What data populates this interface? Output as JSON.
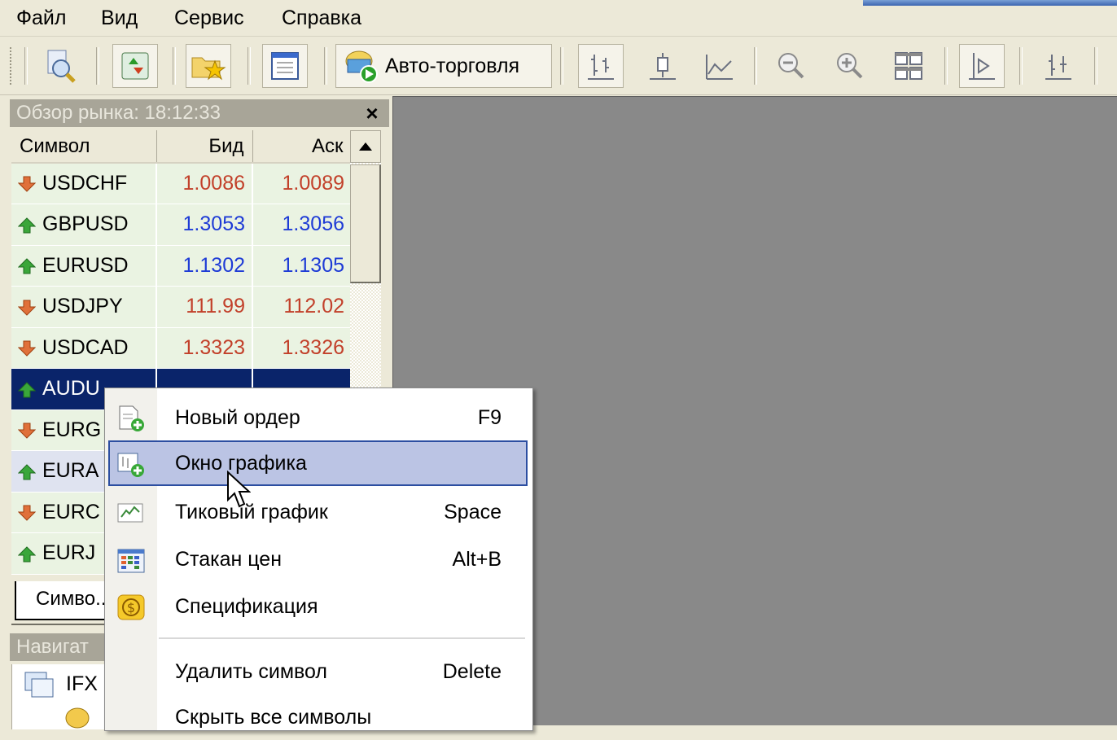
{
  "menubar": {
    "file": "Файл",
    "view": "Вид",
    "service": "Сервис",
    "help": "Справка"
  },
  "toolbar": {
    "autotrade_label": "Авто-торговля"
  },
  "market_watch": {
    "title": "Обзор рынка: 18:12:33",
    "close_symbol": "×",
    "columns": {
      "symbol": "Символ",
      "bid": "Бид",
      "ask": "Аск"
    },
    "rows": [
      {
        "symbol": "USDCHF",
        "bid": "1.0086",
        "ask": "1.0089",
        "direction": "down"
      },
      {
        "symbol": "GBPUSD",
        "bid": "1.3053",
        "ask": "1.3056",
        "direction": "up"
      },
      {
        "symbol": "EURUSD",
        "bid": "1.1302",
        "ask": "1.1305",
        "direction": "up"
      },
      {
        "symbol": "USDJPY",
        "bid": "111.99",
        "ask": "112.02",
        "direction": "down"
      },
      {
        "symbol": "USDCAD",
        "bid": "1.3323",
        "ask": "1.3326",
        "direction": "down"
      },
      {
        "symbol": "AUDU",
        "bid": "",
        "ask": "",
        "direction": "up"
      },
      {
        "symbol": "EURG",
        "bid": "",
        "ask": "",
        "direction": "down"
      },
      {
        "symbol": "EURA",
        "bid": "",
        "ask": "",
        "direction": "up"
      },
      {
        "symbol": "EURC",
        "bid": "",
        "ask": "",
        "direction": "down"
      },
      {
        "symbol": "EURJ",
        "bid": "",
        "ask": "",
        "direction": "up"
      }
    ],
    "tab_label": "Симво..."
  },
  "navigator": {
    "title": "Навигат",
    "item": "IFX"
  },
  "context_menu": {
    "items": [
      {
        "label": "Новый ордер",
        "shortcut": "F9"
      },
      {
        "label": "Окно графика",
        "shortcut": ""
      },
      {
        "label": "Тиковый график",
        "shortcut": "Space"
      },
      {
        "label": "Стакан цен",
        "shortcut": "Alt+B"
      },
      {
        "label": "Спецификация",
        "shortcut": ""
      },
      {
        "label": "Удалить символ",
        "shortcut": "Delete"
      },
      {
        "label": "Скрыть все символы",
        "shortcut": ""
      }
    ]
  },
  "colors": {
    "down": "#c2402a",
    "up": "#1e3bd6",
    "selected_row": "#0a246a",
    "menu_highlight": "#bbc4e4",
    "chart_bg": "#898989"
  }
}
